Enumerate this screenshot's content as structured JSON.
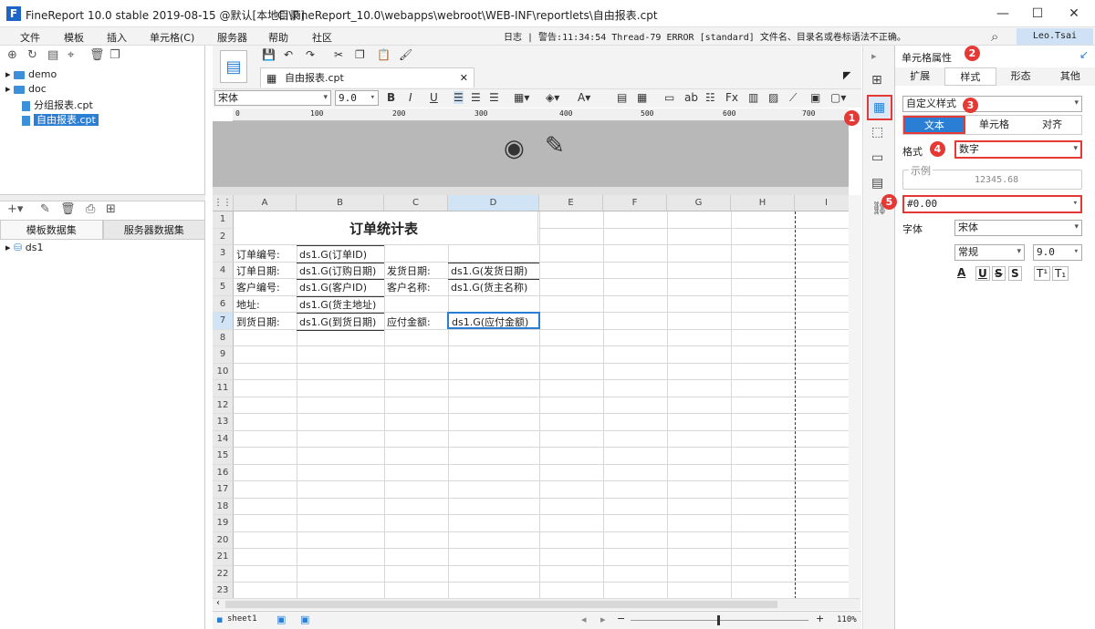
{
  "title": {
    "app": "FineReport 10.0 stable 2019-08-15 @默认[本地目录]",
    "path": "C:\\FineReport_10.0\\webapps\\webroot\\WEB-INF\\reportlets\\自由报表.cpt"
  },
  "menu": [
    "文件",
    "模板",
    "插入",
    "单元格(C)",
    "服务器",
    "帮助",
    "社区"
  ],
  "log": "日志 | 警告:11:34:54 Thread-79 ERROR [standard] 文件名、目录名或卷标语法不正确。",
  "user": "Leo.Tsai",
  "tree": {
    "items": [
      "demo",
      "doc",
      "分组报表.cpt",
      "自由报表.cpt"
    ]
  },
  "datasets": {
    "tabs": [
      "模板数据集",
      "服务器数据集"
    ],
    "items": [
      "ds1"
    ]
  },
  "doc_tab": "自由报表.cpt",
  "font": {
    "name": "宋体",
    "size": "9.0"
  },
  "ruler": [
    "100",
    "200",
    "300",
    "400",
    "500",
    "600",
    "700"
  ],
  "grid": {
    "columns": [
      "A",
      "B",
      "C",
      "D",
      "E",
      "F",
      "G",
      "H",
      "I"
    ],
    "rows": [
      "1",
      "2",
      "3",
      "4",
      "5",
      "6",
      "7",
      "8",
      "9",
      "10",
      "11",
      "12",
      "13",
      "14",
      "15",
      "16",
      "17",
      "18",
      "19",
      "20",
      "21",
      "22",
      "23"
    ],
    "title": "订单统计表",
    "cells": {
      "a3": "订单编号:",
      "b3": "ds1.G(订单ID)",
      "a4": "订单日期:",
      "b4": "ds1.G(订购日期)",
      "c4": "发货日期:",
      "d4": "ds1.G(发货日期)",
      "a5": "客户编号:",
      "b5": "ds1.G(客户ID)",
      "c5": "客户名称:",
      "d5": "ds1.G(货主名称)",
      "a6": "地址:",
      "b6": "ds1.G(货主地址)",
      "a7": "到货日期:",
      "b7": "ds1.G(到货日期)",
      "c7": "应付金额:",
      "d7": "ds1.G(应付金额)"
    }
  },
  "status": {
    "sheet": "sheet1",
    "zoom": "110%"
  },
  "panel": {
    "title": "单元格属性",
    "tabs": [
      "扩展",
      "样式",
      "形态",
      "其他"
    ],
    "style_select": "自定义样式",
    "subtabs": [
      "文本",
      "单元格",
      "对齐"
    ],
    "format_label": "格式",
    "format_value": "数字",
    "example_label": "示例",
    "example_value": "12345.68",
    "pattern": "#0.00",
    "font_label": "字体",
    "font_value": "宋体",
    "font_style": "常规",
    "font_size": "9.0"
  },
  "badges": [
    "1",
    "2",
    "3",
    "4",
    "5"
  ]
}
